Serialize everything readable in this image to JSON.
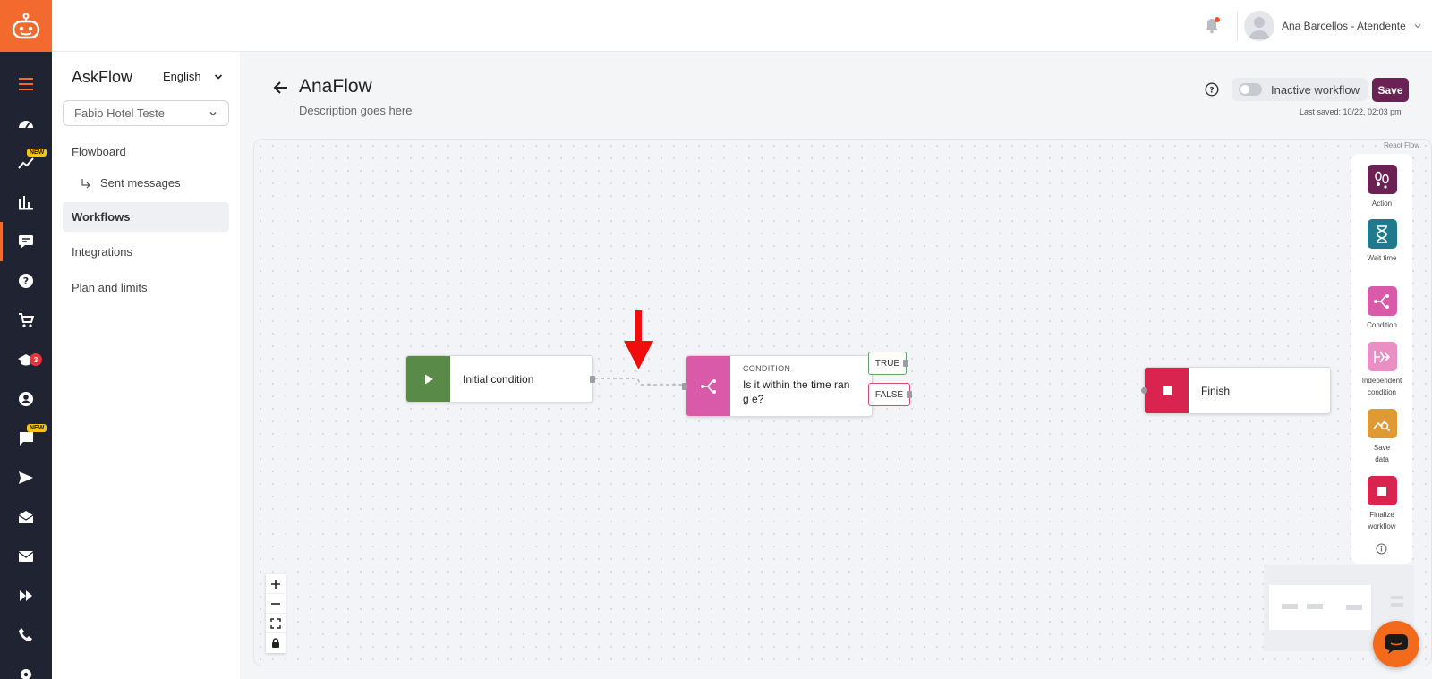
{
  "header": {
    "user_name": "Ana Barcellos - Atendente"
  },
  "rail": {
    "new_badge": "NEW",
    "courses_count": "3"
  },
  "sidebar": {
    "title": "AskFlow",
    "language": "English",
    "account_select": "Fabio Hotel Teste",
    "items": [
      {
        "label": "Flowboard"
      },
      {
        "label": "Sent messages"
      },
      {
        "label": "Workflows"
      },
      {
        "label": "Integrations"
      },
      {
        "label": "Plan and limits"
      }
    ]
  },
  "workflow": {
    "title": "AnaFlow",
    "description": "Description goes here",
    "toggle_label": "Inactive workflow",
    "save_label": "Save",
    "last_saved": "Last saved: 10/22, 02:03 pm"
  },
  "canvas": {
    "attribution": "React Flow",
    "nodes": {
      "start": {
        "label": "Initial condition",
        "color": "#5a8a47"
      },
      "condition": {
        "kicker": "CONDITION",
        "label": "Is it within the time rang e?",
        "color": "#d95aa8"
      },
      "true_label": "TRUE",
      "false_label": "FALSE",
      "finish": {
        "label": "Finish",
        "color": "#d9244f"
      }
    }
  },
  "palette": [
    {
      "label": "Action",
      "color": "#6b2153",
      "icon": "footprints-icon"
    },
    {
      "label": "Wait time",
      "color": "#1f7a8c",
      "icon": "hourglass-icon"
    },
    {
      "label": "Condition",
      "color": "#d95aa8",
      "icon": "branch-icon"
    },
    {
      "label": "Independent condition",
      "color": "#e88fc4",
      "icon": "fork-icon"
    },
    {
      "label": "Save data",
      "color": "#e09a35",
      "icon": "chart-search-icon"
    },
    {
      "label": "Finalize workflow",
      "color": "#d9244f",
      "icon": "stop-icon"
    }
  ]
}
